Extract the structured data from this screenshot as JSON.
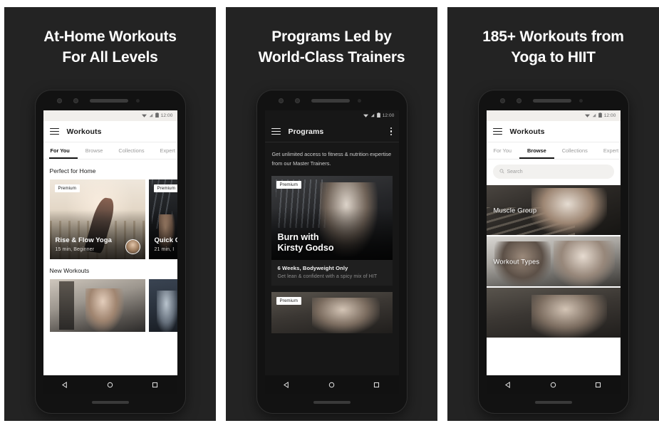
{
  "panels": [
    {
      "headline_line1": "At-Home Workouts",
      "headline_line2": "For All Levels",
      "status": {
        "time": "12:00"
      },
      "appbar": {
        "title": "Workouts",
        "menu_icon": "hamburger-icon"
      },
      "tabs": [
        {
          "label": "For You",
          "active": true
        },
        {
          "label": "Browse",
          "active": false
        },
        {
          "label": "Collections",
          "active": false
        },
        {
          "label": "Expert",
          "active": false
        }
      ],
      "sections": [
        {
          "title": "Perfect for Home",
          "cards": [
            {
              "badge": "Premium",
              "title": "Rise & Flow Yoga",
              "subtitle": "15 min, Beginner"
            },
            {
              "badge": "Premium",
              "title": "Quick C",
              "subtitle": "21 min, I"
            }
          ]
        },
        {
          "title": "New Workouts",
          "cards": []
        }
      ]
    },
    {
      "headline_line1": "Programs Led by",
      "headline_line2": "World-Class Trainers",
      "status": {
        "time": "12:00"
      },
      "appbar": {
        "title": "Programs",
        "menu_icon": "hamburger-icon",
        "overflow_icon": "kebab-icon"
      },
      "intro": "Get unlimited access to fitness & nutrition expertise from our Master Trainers.",
      "program_card": {
        "badge": "Premium",
        "title_line1": "Burn with",
        "title_line2": "Kirsty Godso",
        "meta": "6 Weeks, Bodyweight Only",
        "description": "Get lean & confident with a spicy mix of HIT"
      },
      "program_card_2": {
        "badge": "Premium"
      }
    },
    {
      "headline_line1": "185+ Workouts from",
      "headline_line2": "Yoga to HIIT",
      "status": {
        "time": "12:00"
      },
      "appbar": {
        "title": "Workouts",
        "menu_icon": "hamburger-icon"
      },
      "tabs": [
        {
          "label": "For You",
          "active": false
        },
        {
          "label": "Browse",
          "active": true
        },
        {
          "label": "Collections",
          "active": false
        },
        {
          "label": "Expert",
          "active": false
        }
      ],
      "search": {
        "placeholder": "Search",
        "icon": "search-icon"
      },
      "tiles": [
        {
          "label": "Muscle Group"
        },
        {
          "label": "Workout Types"
        },
        {
          "label": ""
        }
      ]
    }
  ],
  "navigation": {
    "back_icon": "triangle-back-icon",
    "home_icon": "circle-home-icon",
    "recents_icon": "square-recents-icon"
  },
  "colors": {
    "panel_background": "#232323",
    "page_background": "#ffffff",
    "phone_body": "#121212",
    "accent_text": "#ffffff"
  }
}
